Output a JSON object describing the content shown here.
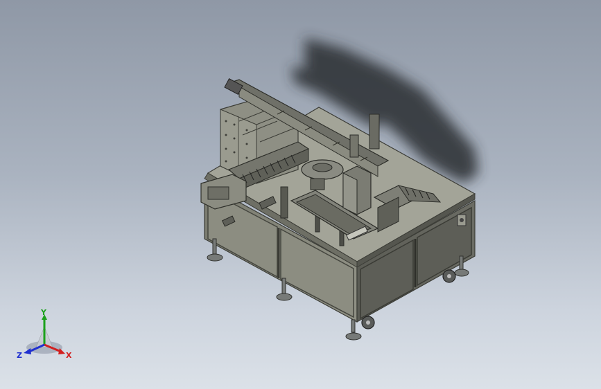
{
  "viewport": {
    "background_top": "#8f98a6",
    "background_bottom": "#dbe1e8"
  },
  "model": {
    "icon": "machine-assembly-model",
    "frame_color": "#5c5e55",
    "panel_color": "#8a8b7f",
    "top_color": "#a9aa9e"
  },
  "triad": {
    "x_label": "X",
    "y_label": "Y",
    "z_label": "Z",
    "x_color": "#d22020",
    "y_color": "#1ca11c",
    "z_color": "#2030d0"
  }
}
